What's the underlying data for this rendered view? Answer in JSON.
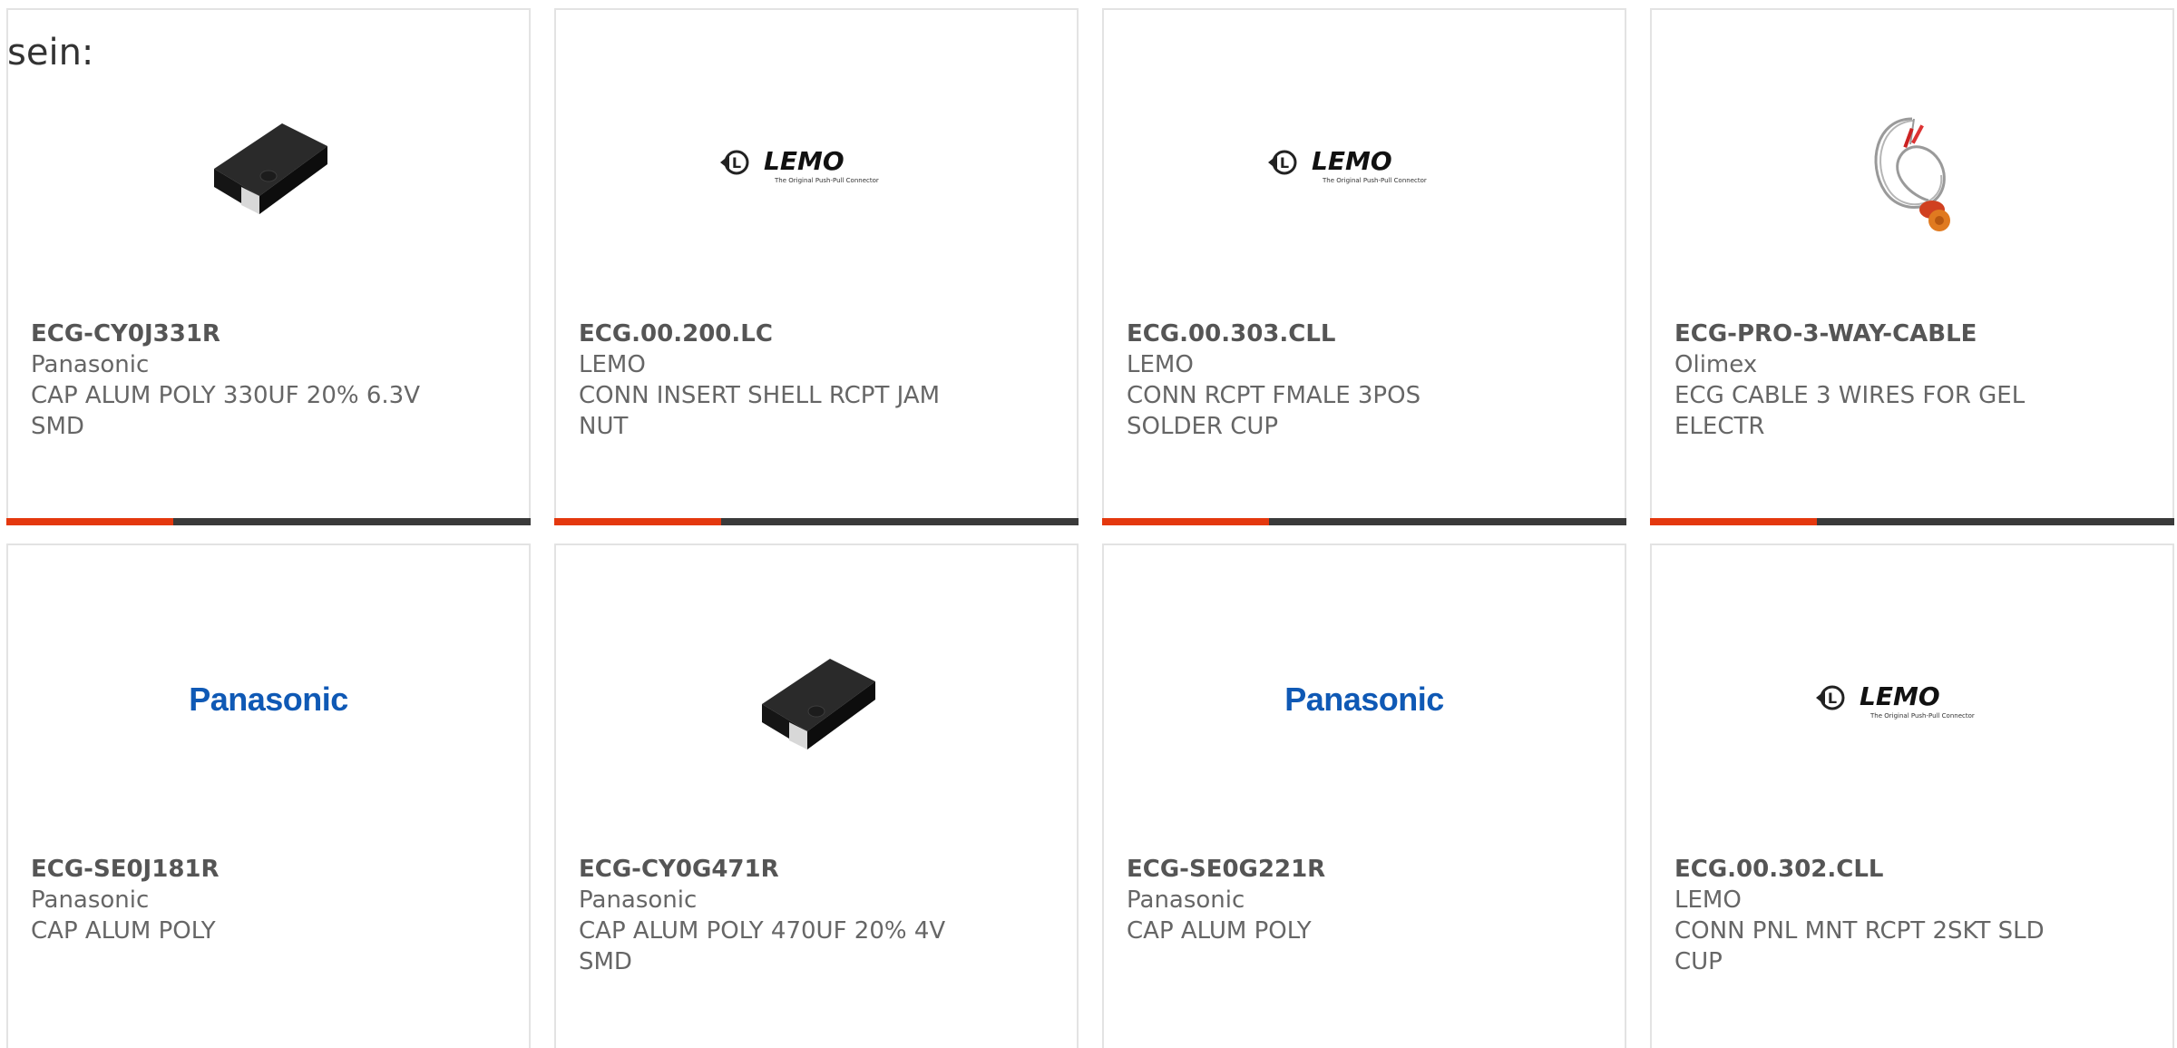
{
  "intro_text": "sein:",
  "colors": {
    "accent": "#e4380e",
    "bar": "#3a3a3a",
    "panasonic_blue": "#0f59b5"
  },
  "products": [
    {
      "part_number": "ECG-CY0J331R",
      "manufacturer": "Panasonic",
      "description_line1": "CAP ALUM POLY 330UF 20% 6.3V",
      "description_line2": "SMD",
      "image": "capacitor-chip-icon"
    },
    {
      "part_number": "ECG.00.200.LC",
      "manufacturer": "LEMO",
      "description_line1": "CONN INSERT SHELL RCPT JAM",
      "description_line2": "NUT",
      "image": "lemo-logo",
      "logo_text": "LEMO",
      "logo_tagline": "The Original Push-Pull Connector"
    },
    {
      "part_number": "ECG.00.303.CLL",
      "manufacturer": "LEMO",
      "description_line1": "CONN RCPT FMALE 3POS",
      "description_line2": "SOLDER CUP",
      "image": "lemo-logo",
      "logo_text": "LEMO",
      "logo_tagline": "The Original Push-Pull Connector"
    },
    {
      "part_number": "ECG-PRO-3-WAY-CABLE",
      "manufacturer": "Olimex",
      "description_line1": "ECG CABLE 3 WIRES FOR GEL",
      "description_line2": "ELECTR",
      "image": "cable-icon"
    },
    {
      "part_number": "ECG-SE0J181R",
      "manufacturer": "Panasonic",
      "description_line1": "CAP ALUM POLY",
      "description_line2": "",
      "image": "panasonic-logo",
      "logo_text": "Panasonic"
    },
    {
      "part_number": "ECG-CY0G471R",
      "manufacturer": "Panasonic",
      "description_line1": "CAP ALUM POLY 470UF 20% 4V",
      "description_line2": "SMD",
      "image": "capacitor-chip-icon"
    },
    {
      "part_number": "ECG-SE0G221R",
      "manufacturer": "Panasonic",
      "description_line1": "CAP ALUM POLY",
      "description_line2": "",
      "image": "panasonic-logo",
      "logo_text": "Panasonic"
    },
    {
      "part_number": "ECG.00.302.CLL",
      "manufacturer": "LEMO",
      "description_line1": "CONN PNL MNT RCPT 2SKT SLD",
      "description_line2": "CUP",
      "image": "lemo-logo",
      "logo_text": "LEMO",
      "logo_tagline": "The Original Push-Pull Connector"
    }
  ]
}
